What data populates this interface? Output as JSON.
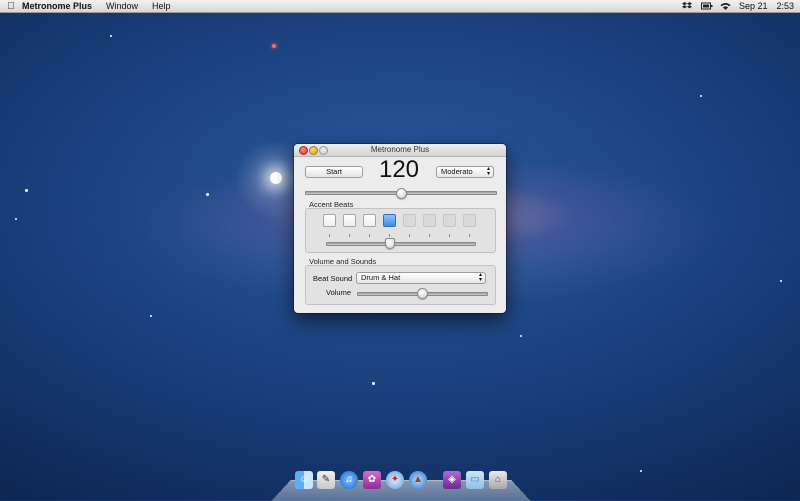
{
  "menubar": {
    "app_name": "Metronome Plus",
    "menus": [
      "Window",
      "Help"
    ],
    "date": "Sep 21",
    "time": "2:53",
    "tray_icons": [
      "dropbox-icon",
      "battery-icon",
      "wifi-icon"
    ]
  },
  "window": {
    "title": "Metronome Plus",
    "start_label": "Start",
    "tempo_value": "120",
    "tempo_marking": "Moderato",
    "tempo_slider_fraction": 0.5,
    "accent": {
      "group_label": "Accent Beats",
      "beat_count_active": 4,
      "accent_beat_index": 4,
      "slider_fraction": 0.43
    },
    "volume_sounds": {
      "group_label": "Volume and Sounds",
      "beat_sound_label": "Beat Sound",
      "beat_sound_value": "Drum & Hat",
      "volume_label": "Volume",
      "volume_fraction": 0.5
    }
  },
  "dock": {
    "icons": [
      "finder-icon",
      "app-store-icon",
      "itunes-icon",
      "photo-app-icon",
      "safari-icon",
      "metronome-icon",
      "app-icon",
      "folder-icon",
      "trash-icon"
    ]
  }
}
